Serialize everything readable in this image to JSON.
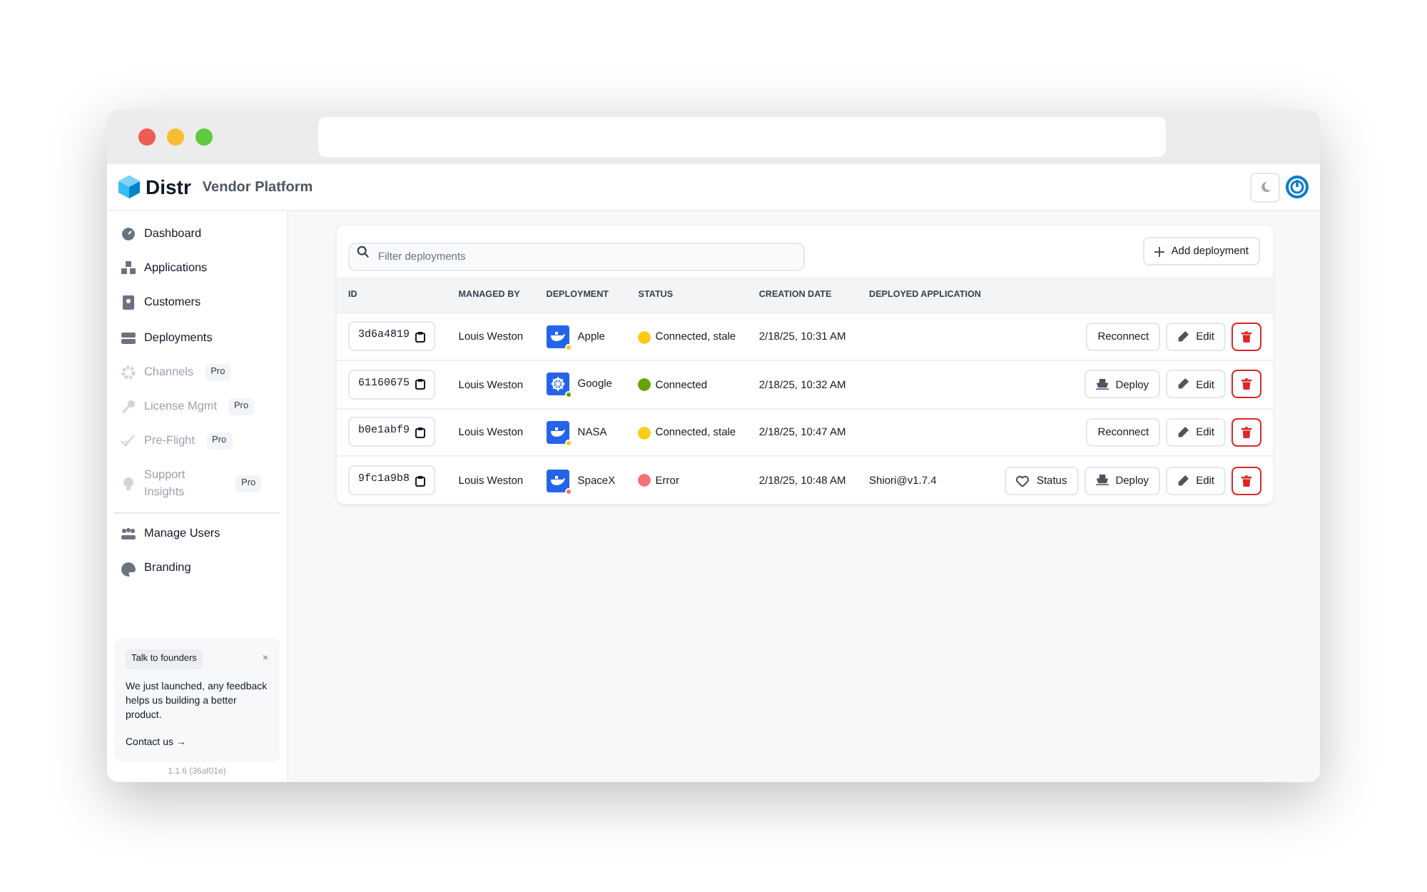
{
  "app": {
    "logo": "Distr",
    "subtitle": "Vendor Platform"
  },
  "sidebar": {
    "items": [
      {
        "label": "Dashboard",
        "disabled": false
      },
      {
        "label": "Applications",
        "disabled": false
      },
      {
        "label": "Customers",
        "disabled": false
      },
      {
        "label": "Deployments",
        "disabled": false
      },
      {
        "label": "Channels",
        "disabled": true,
        "badge": "Pro"
      },
      {
        "label": "License Mgmt",
        "disabled": true,
        "badge": "Pro"
      },
      {
        "label": "Pre-Flight",
        "disabled": true,
        "badge": "Pro"
      },
      {
        "label": "Support Insights",
        "disabled": true,
        "badge": "Pro"
      }
    ],
    "admin_items": [
      {
        "label": "Manage Users",
        "disabled": false
      },
      {
        "label": "Branding",
        "disabled": false
      }
    ],
    "notice": {
      "tag": "Talk to founders",
      "close": "×",
      "text": "We just launched, any feedback helps us building a better product.",
      "link": "Contact us",
      "link_arrow": "→"
    },
    "version": "1.1.6 (36af01e)"
  },
  "toolbar": {
    "search_placeholder": "Filter deployments",
    "add_button": "Add deployment"
  },
  "table": {
    "columns": [
      "ID",
      "MANAGED BY",
      "DEPLOYMENT",
      "STATUS",
      "CREATION DATE",
      "DEPLOYED APPLICATION"
    ],
    "rows": [
      {
        "id": "3d6a4819",
        "managed_by": "Louis Weston",
        "kind": "docker",
        "deployment": "Apple",
        "status": "Connected, stale",
        "color": "#facc15",
        "created": "2/18/25, 10:31 AM",
        "actions": [
          {
            "kind": "reconnect",
            "label": "Reconnect"
          },
          {
            "kind": "edit",
            "label": "Edit"
          },
          {
            "kind": "delete"
          }
        ]
      },
      {
        "id": "61160675",
        "managed_by": "Louis Weston",
        "kind": "kubernetes",
        "deployment": "Google",
        "status": "Connected",
        "color": "#65a30d",
        "created": "2/18/25, 10:32 AM",
        "actions": [
          {
            "kind": "deploy",
            "label": "Deploy"
          },
          {
            "kind": "edit",
            "label": "Edit"
          },
          {
            "kind": "delete"
          }
        ]
      },
      {
        "id": "b0e1abf9",
        "managed_by": "Louis Weston",
        "kind": "docker",
        "deployment": "NASA",
        "status": "Connected, stale",
        "color": "#facc15",
        "created": "2/18/25, 10:47 AM",
        "actions": [
          {
            "kind": "reconnect",
            "label": "Reconnect"
          },
          {
            "kind": "edit",
            "label": "Edit"
          },
          {
            "kind": "delete"
          }
        ]
      },
      {
        "id": "9fc1a9b8",
        "managed_by": "Louis Weston",
        "kind": "docker",
        "deployment": "SpaceX",
        "status": "Error",
        "color": "#f87171",
        "created": "2/18/25, 10:48 AM",
        "application": "Shiori@v1.7.4",
        "actions": [
          {
            "kind": "status",
            "label": "Status"
          },
          {
            "kind": "deploy",
            "label": "Deploy"
          },
          {
            "kind": "edit",
            "label": "Edit"
          },
          {
            "kind": "delete"
          }
        ]
      }
    ]
  }
}
